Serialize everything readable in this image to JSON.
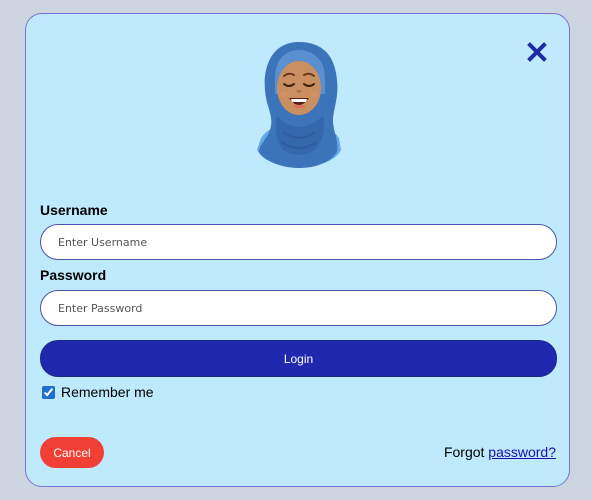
{
  "login": {
    "username_label": "Username",
    "username_placeholder": "Enter Username",
    "password_label": "Password",
    "password_placeholder": "Enter Password",
    "login_label": "Login",
    "remember_label": "Remember me",
    "remember_checked": true,
    "cancel_label": "Cancel",
    "forgot_prefix": "Forgot ",
    "forgot_link": "password?"
  },
  "icons": {
    "close": "close-icon",
    "avatar": "avatar-hijab-woman"
  },
  "colors": {
    "background": "#cdd5e1",
    "modal": "#bfeafd",
    "primary": "#2128b0",
    "cancel": "#f23f35",
    "link": "#1a0dab"
  }
}
